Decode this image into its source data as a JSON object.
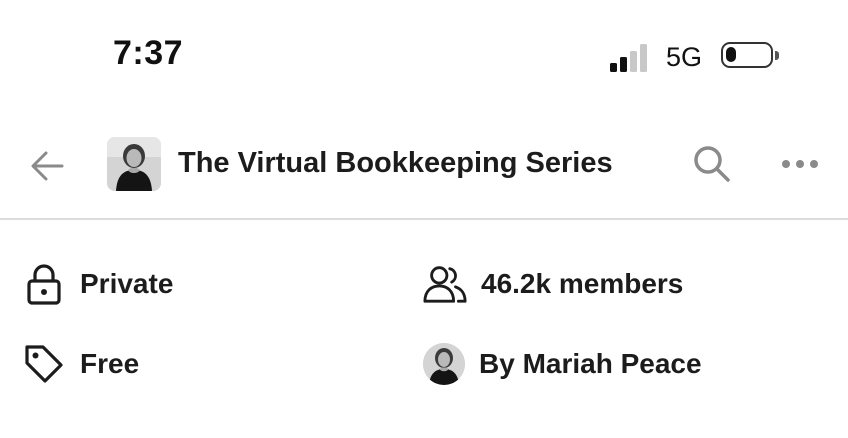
{
  "status_bar": {
    "time": "7:37",
    "network": "5G",
    "signal_bars_active": 2,
    "signal_bars_total": 4,
    "battery_level": 0.25
  },
  "header": {
    "title": "The Virtual Bookkeeping Series",
    "back_icon": "arrow-left-icon",
    "search_icon": "search-icon",
    "more_icon": "more-horizontal-icon"
  },
  "info": {
    "privacy": "Private",
    "members": "46.2k members",
    "price": "Free",
    "creator": "By Mariah Peace"
  },
  "colors": {
    "icon_gray": "#8a8a8a",
    "text_dark": "#1c1c1c",
    "divider": "#dcdcdc"
  }
}
